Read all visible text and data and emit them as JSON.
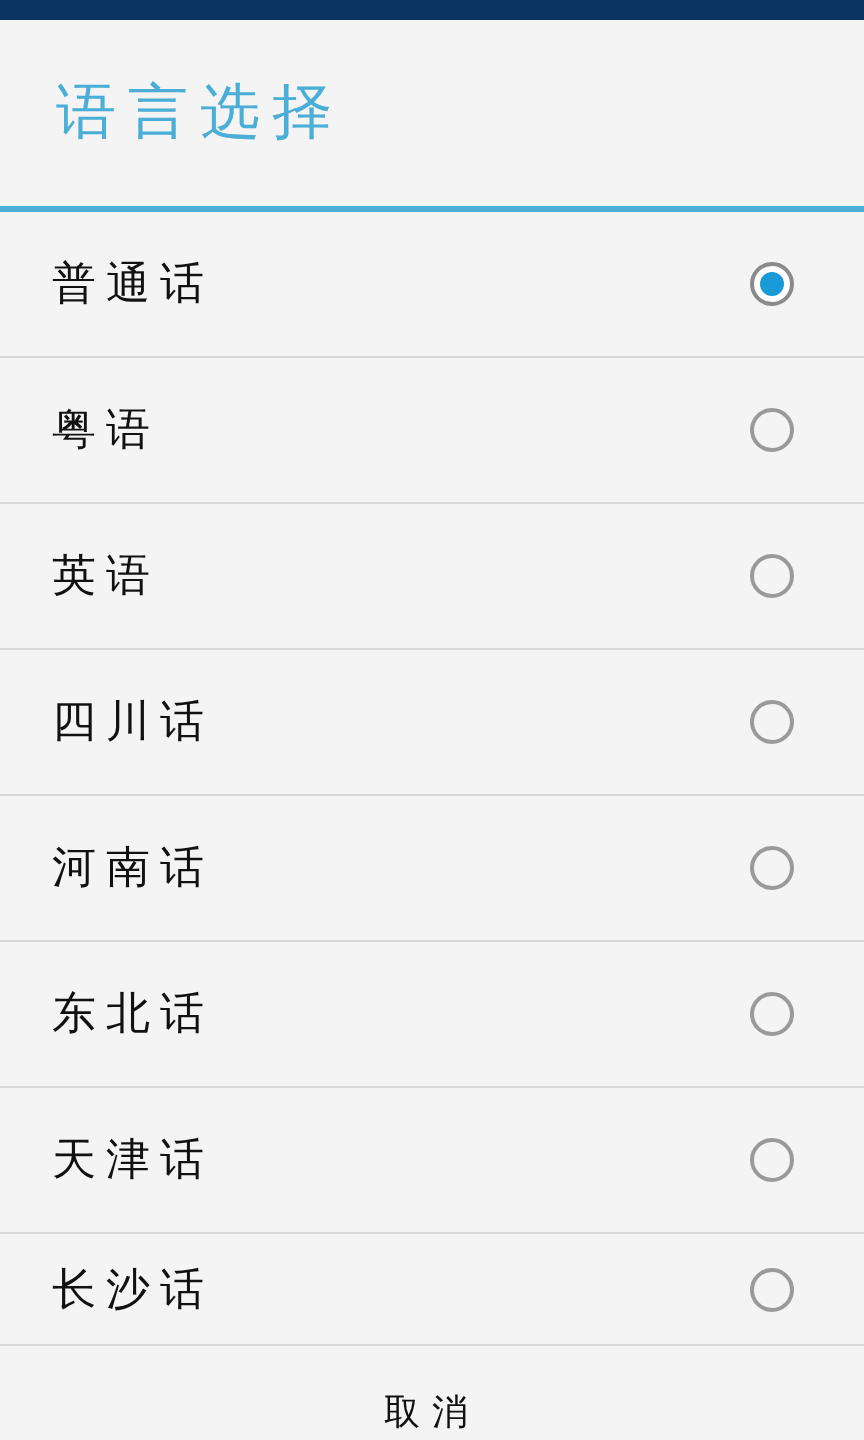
{
  "dialog": {
    "title": "语言选择",
    "options": [
      {
        "label": "普通话",
        "selected": true
      },
      {
        "label": "粤语",
        "selected": false
      },
      {
        "label": "英语",
        "selected": false
      },
      {
        "label": "四川话",
        "selected": false
      },
      {
        "label": "河南话",
        "selected": false
      },
      {
        "label": "东北话",
        "selected": false
      },
      {
        "label": "天津话",
        "selected": false
      },
      {
        "label": "长沙话",
        "selected": false
      }
    ],
    "buttons": [
      "取消"
    ]
  }
}
